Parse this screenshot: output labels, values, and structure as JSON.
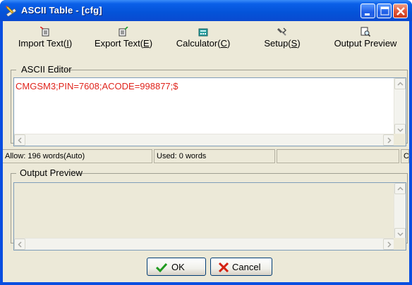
{
  "window": {
    "title": "ASCII Table - [cfg]"
  },
  "icons": {
    "app": "pencil-ruler-icon",
    "minimize": "minimize-icon",
    "maximize": "maximize-icon",
    "close": "close-icon",
    "import": "import-text-icon",
    "export": "export-text-icon",
    "calculator": "calculator-icon",
    "setup": "setup-icon",
    "preview": "output-preview-icon",
    "ok": "checkmark-icon",
    "cancel": "cross-icon"
  },
  "toolbar": {
    "import": {
      "text": "Import Text(",
      "key": "I",
      "end": ")"
    },
    "export": {
      "text": "Export Text(",
      "key": "E",
      "end": ")"
    },
    "calculator": {
      "text": "Calculator(",
      "key": "C",
      "end": ")"
    },
    "setup": {
      "text": "Setup(",
      "key": "S",
      "end": ")"
    },
    "preview": {
      "text": "Output Preview"
    }
  },
  "editor": {
    "label": "ASCII Editor",
    "content": "CMGSM3;PIN=7608;ACODE=998877;$"
  },
  "status": {
    "allow": "Allow: 196 words(Auto)",
    "used": "Used: 0 words",
    "empty": "",
    "cur": "Cur"
  },
  "preview": {
    "label": "Output Preview",
    "content": ""
  },
  "buttons": {
    "ok": "OK",
    "cancel": "Cancel"
  },
  "colors": {
    "editor_text": "#e0241c",
    "titlebar": "#0a5fe8",
    "face": "#ece9d8"
  }
}
